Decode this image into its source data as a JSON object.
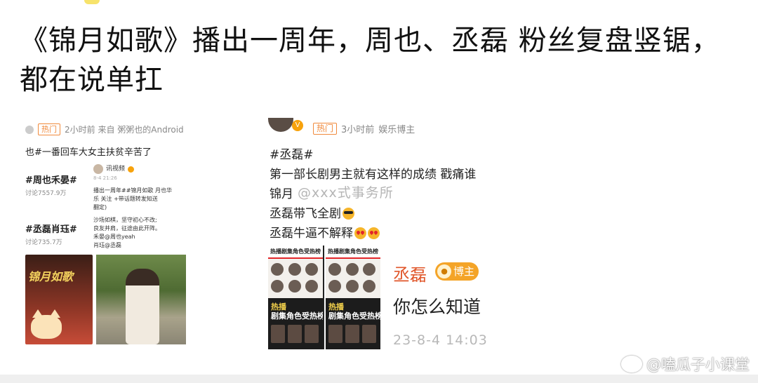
{
  "headline": "《锦月如歌》播出一周年，周也、丞磊 粉丝复盘竖锯，都在说单扛",
  "left_post": {
    "hot_tag": "热门",
    "meta": "2小时前  来自 粥粥也的Android",
    "text": "也#一番回车大女主扶贫辛苦了",
    "topics": [
      {
        "title": "#周也禾晏#",
        "sub": "讨论7557.9万"
      },
      {
        "title": "#丞磊肖珏#",
        "sub": "讨论735.7万"
      }
    ],
    "mini_post": {
      "name": "讯视频",
      "time": "8-4 21:26",
      "lines": [
        "播出一周年##锦月如歌 月也华",
        "乐 关注 +带话题转发知送",
        "翻定)",
        "沙场如棋，坚守初心不改;",
        "良友并肩，征途由此开阵。",
        "禾晏@周也yeah",
        "肖珏@丞磊"
      ]
    },
    "poster_title": "锦月如歌"
  },
  "right_post": {
    "hot_tag": "热门",
    "time": "3小时前",
    "source": "娱乐博主",
    "lines": [
      "#丞磊#",
      "第一部长剧男主就有这样的成绩 戳痛谁",
      "锦月",
      "丞磊带飞全剧",
      "丞磊牛逼不解释"
    ],
    "overlay_watermark": "@xxx式事务所",
    "rank_title": "热播剧集角色受热榜",
    "rank_title2_a": "热播",
    "rank_title2_b": "剧集角色受热榜"
  },
  "reply": {
    "name": "丞磊",
    "badge": "博主",
    "text": "你怎么知道",
    "time": "23-8-4 14:03"
  },
  "watermark": "@嗑瓜子小课堂"
}
